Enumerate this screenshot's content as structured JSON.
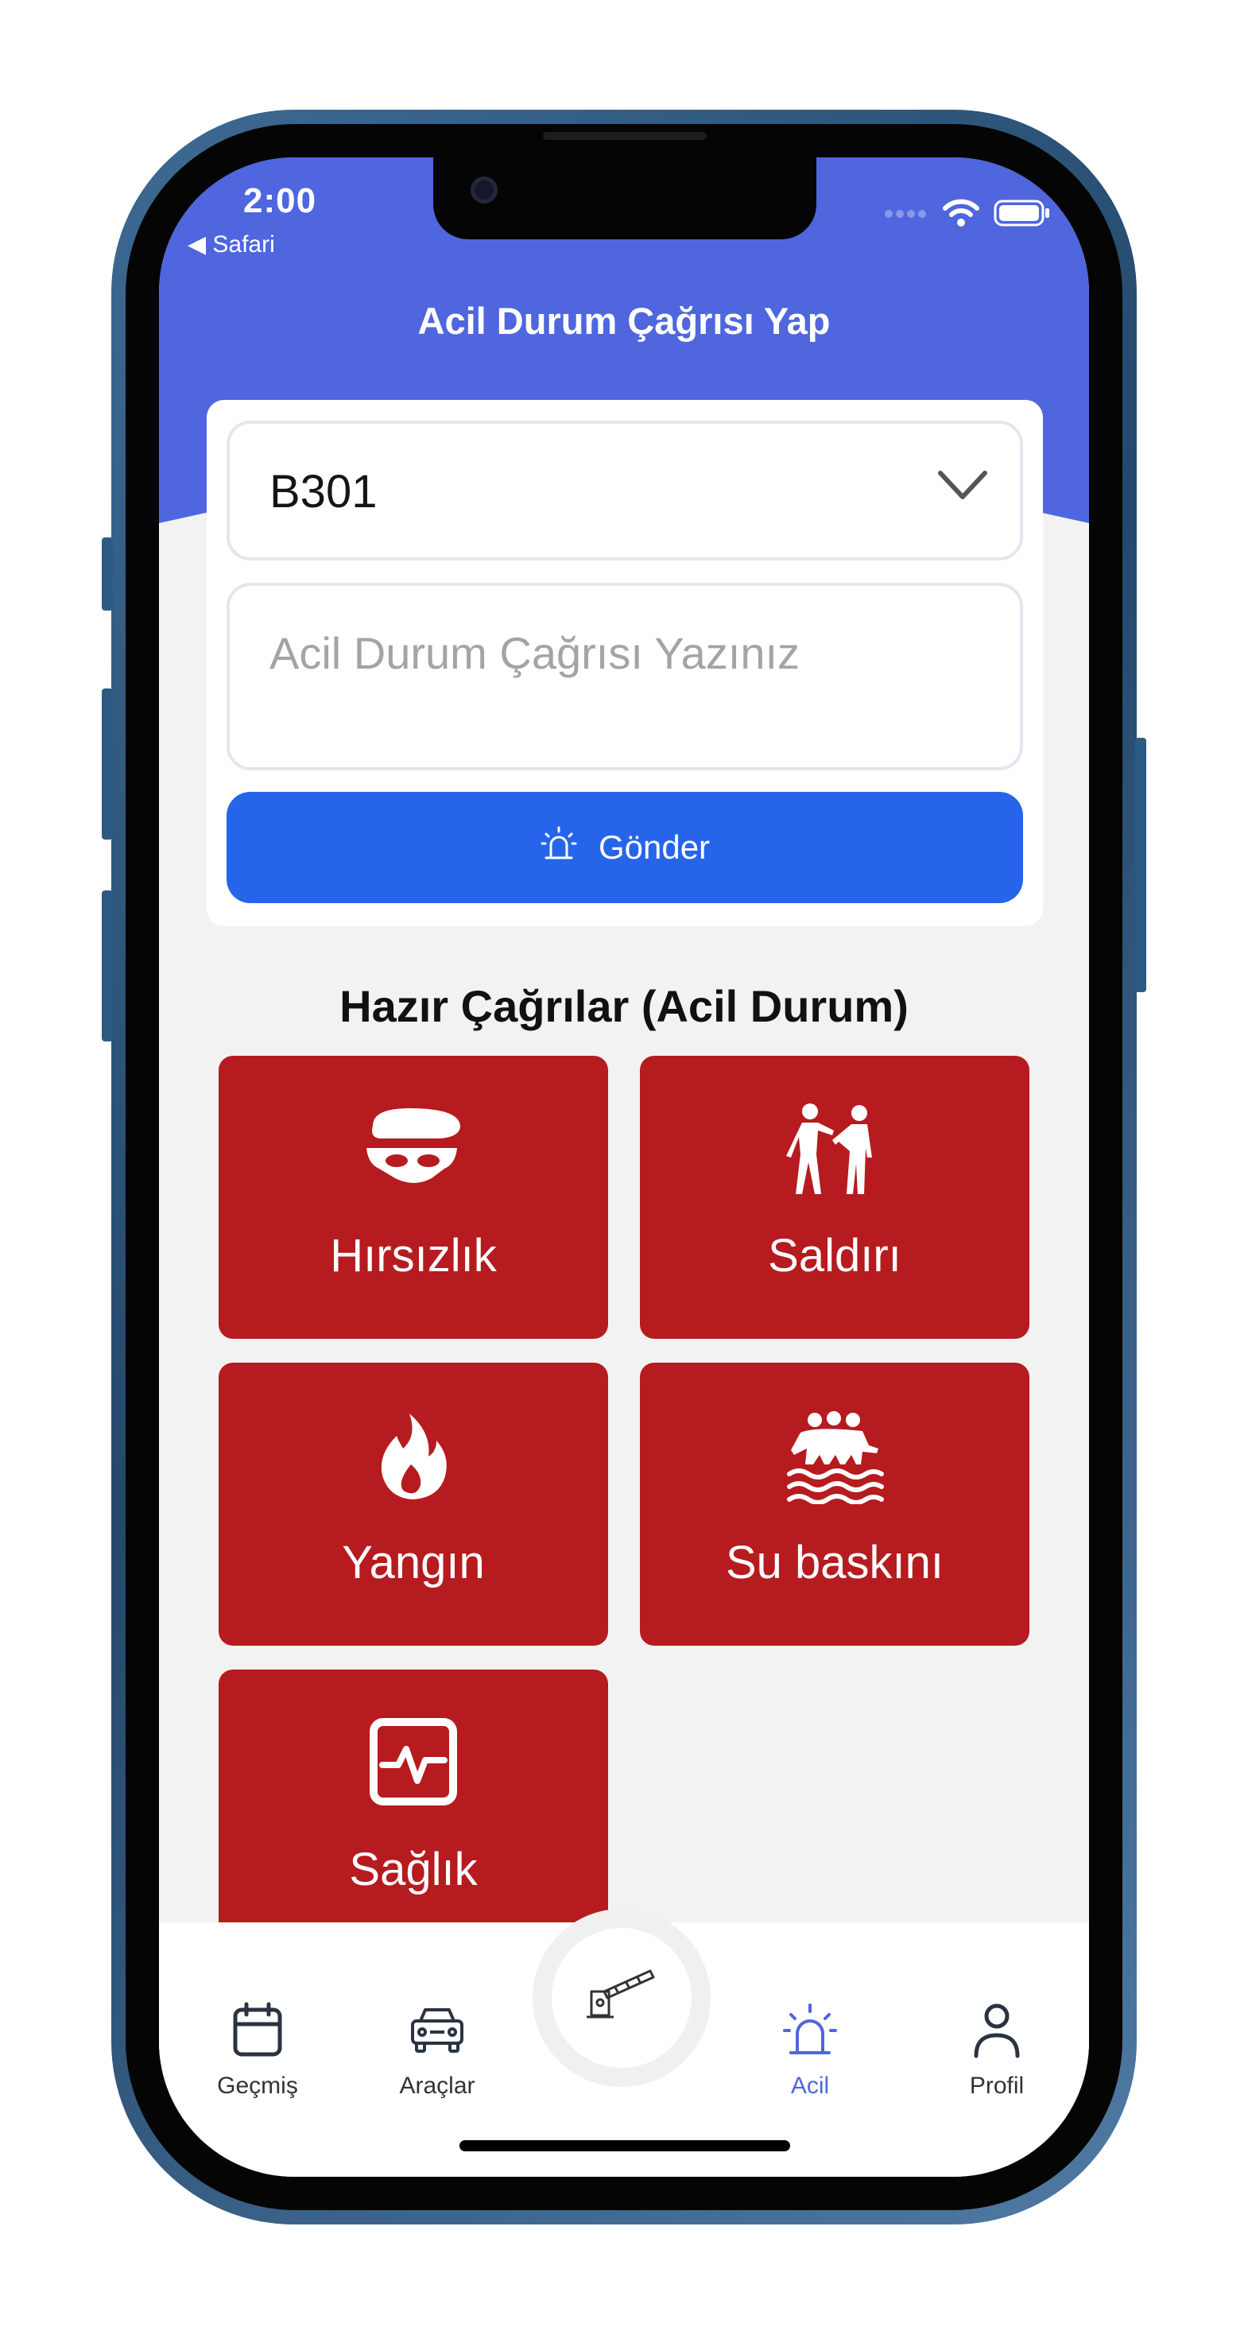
{
  "status_bar": {
    "time": "2:00",
    "back_label": "◀ Safari"
  },
  "header": {
    "title": "Acil Durum Çağrısı Yap",
    "color": "#4f66df"
  },
  "form": {
    "selected_unit": "B301",
    "message_placeholder": "Acil Durum Çağrısı Yazınız",
    "message_value": "",
    "send_label": "Gönder",
    "send_color": "#2665ea"
  },
  "presets": {
    "title": "Hazır Çağrılar (Acil Durum)",
    "tile_color": "#b61b1f",
    "items": [
      {
        "label": "Hırsızlık",
        "icon": "thief-mask-icon"
      },
      {
        "label": "Saldırı",
        "icon": "assault-people-icon"
      },
      {
        "label": "Yangın",
        "icon": "fire-icon"
      },
      {
        "label": "Su baskını",
        "icon": "flood-icon"
      },
      {
        "label": "Sağlık",
        "icon": "health-monitor-icon"
      }
    ]
  },
  "bottom_nav": {
    "active_color": "#4f66df",
    "items": [
      {
        "label": "Geçmiş",
        "icon": "calendar-icon"
      },
      {
        "label": "Araçlar",
        "icon": "car-icon"
      },
      {
        "label": "Acil",
        "icon": "siren-icon",
        "active": true
      },
      {
        "label": "Profil",
        "icon": "user-icon"
      }
    ],
    "center_icon": "barrier-gate-icon"
  }
}
